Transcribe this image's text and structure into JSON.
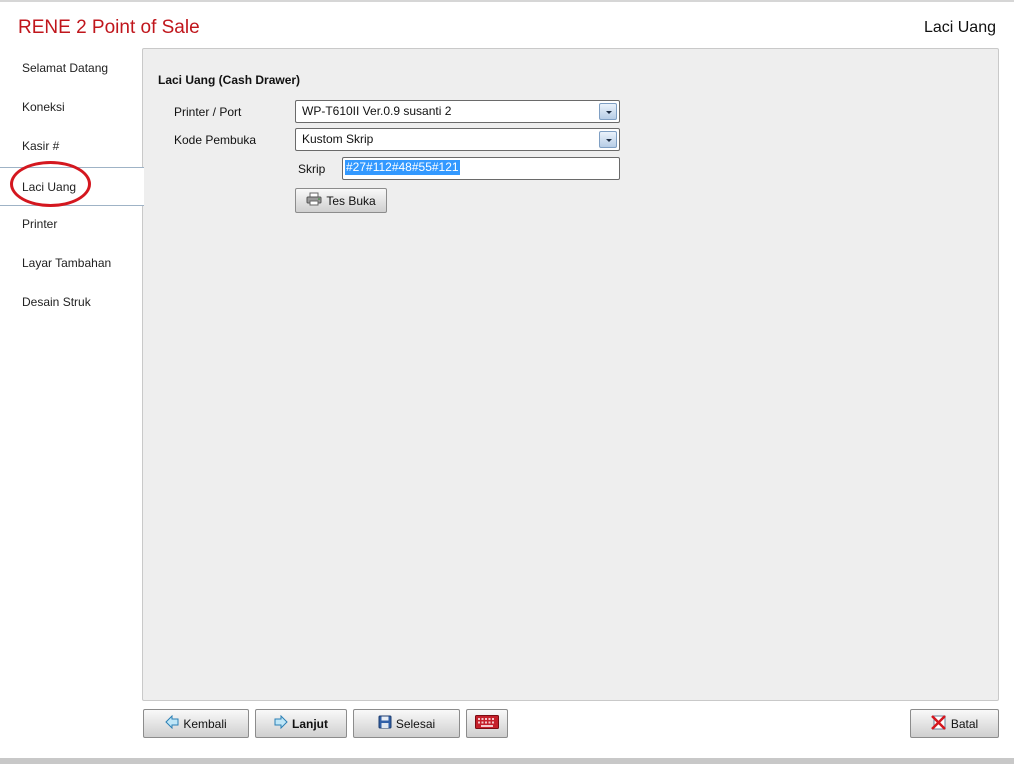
{
  "header": {
    "app_title": "RENE 2 Point of Sale",
    "page_title": "Laci Uang"
  },
  "sidebar": {
    "active": "Laci Uang",
    "items": [
      {
        "label": "Selamat Datang"
      },
      {
        "label": "Koneksi"
      },
      {
        "label": "Kasir #"
      },
      {
        "label": "Laci Uang"
      },
      {
        "label": "Printer"
      },
      {
        "label": "Layar Tambahan"
      },
      {
        "label": "Desain Struk"
      }
    ]
  },
  "form": {
    "section_title": "Laci Uang (Cash Drawer)",
    "printer_port": {
      "label": "Printer / Port",
      "value": "WP-T610II Ver.0.9 susanti 2"
    },
    "kode_pembuka": {
      "label": "Kode Pembuka",
      "value": "Kustom Skrip"
    },
    "skrip": {
      "label": "Skrip",
      "value": "#27#112#48#55#121"
    },
    "test_button": {
      "label": "Tes Buka",
      "icon": "printer-icon"
    }
  },
  "footer": {
    "back": {
      "label": "Kembali",
      "icon": "arrow-left-icon"
    },
    "next": {
      "label": "Lanjut",
      "icon": "arrow-right-icon"
    },
    "finish": {
      "label": "Selesai",
      "icon": "save-disk-icon"
    },
    "keyboard": {
      "icon": "keyboard-icon"
    },
    "cancel": {
      "label": "Batal",
      "icon": "cancel-icon"
    }
  },
  "colors": {
    "title_red": "#c0161c",
    "highlight_ring": "#d4171f",
    "selection_blue": "#3399ff",
    "panel_bg": "#eeeeee"
  }
}
